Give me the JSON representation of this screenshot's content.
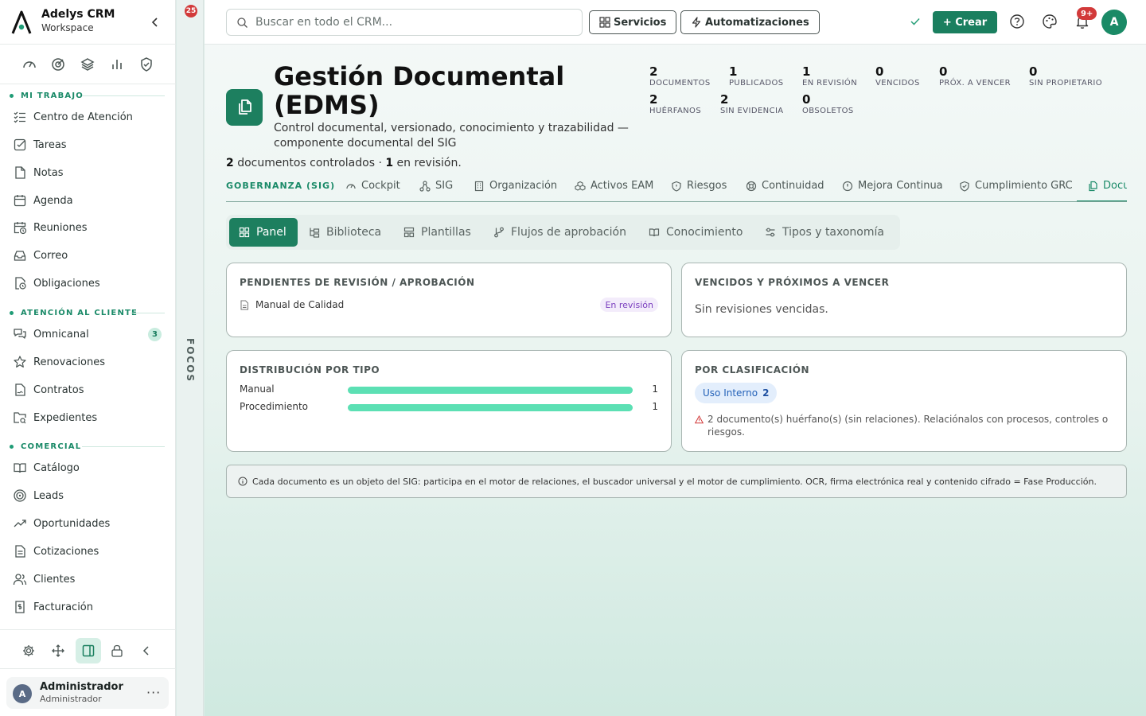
{
  "app": {
    "name": "Adelys CRM",
    "workspace": "Workspace"
  },
  "sidebar": {
    "sections": [
      {
        "title": "MI TRABAJO",
        "items": [
          {
            "label": "Centro de Atención",
            "icon": "list-check-icon"
          },
          {
            "label": "Tareas",
            "icon": "checkbox-icon"
          },
          {
            "label": "Notas",
            "icon": "note-icon"
          },
          {
            "label": "Agenda",
            "icon": "calendar-icon"
          },
          {
            "label": "Reuniones",
            "icon": "calendar-clock-icon"
          },
          {
            "label": "Correo",
            "icon": "inbox-icon"
          },
          {
            "label": "Obligaciones",
            "icon": "file-clock-icon"
          }
        ]
      },
      {
        "title": "ATENCIÓN AL CLIENTE",
        "items": [
          {
            "label": "Omnicanal",
            "icon": "chat-icon",
            "badge": "3"
          },
          {
            "label": "Renovaciones",
            "icon": "star-icon"
          },
          {
            "label": "Contratos",
            "icon": "file-signature-icon"
          },
          {
            "label": "Expedientes",
            "icon": "folder-search-icon"
          }
        ]
      },
      {
        "title": "COMERCIAL",
        "items": [
          {
            "label": "Catálogo",
            "icon": "book-open-icon"
          },
          {
            "label": "Leads",
            "icon": "target-icon"
          },
          {
            "label": "Oportunidades",
            "icon": "trending-up-icon"
          },
          {
            "label": "Cotizaciones",
            "icon": "file-text-icon"
          },
          {
            "label": "Clientes",
            "icon": "users-icon"
          },
          {
            "label": "Facturación",
            "icon": "receipt-icon"
          }
        ]
      }
    ],
    "user": {
      "initial": "A",
      "name": "Administrador",
      "role": "Administrador",
      "more": "···"
    }
  },
  "focos": {
    "label": "FOCOS",
    "badge": "25"
  },
  "topbar": {
    "search_placeholder": "Buscar en todo el CRM...",
    "services_label": "Servicios",
    "automations_label": "Automatizaciones",
    "create_label": "+ Crear",
    "notifications_badge": "9+",
    "avatar_initial": "A"
  },
  "page": {
    "title": "Gestión Documental (EDMS)",
    "description": "Control documental, versionado, conocimiento y trazabilidad — componente documental del SIG",
    "summary": {
      "count_docs": "2",
      "docs_text": " documentos controlados · ",
      "count_review": "1",
      "review_text": " en revisión."
    }
  },
  "kpis": [
    {
      "value": "2",
      "label": "DOCUMENTOS"
    },
    {
      "value": "1",
      "label": "PUBLICADOS"
    },
    {
      "value": "1",
      "label": "EN REVISIÓN"
    },
    {
      "value": "0",
      "label": "VENCIDOS"
    },
    {
      "value": "0",
      "label": "PRÓX. A VENCER"
    },
    {
      "value": "0",
      "label": "SIN PROPIETARIO"
    },
    {
      "value": "2",
      "label": "HUÉRFANOS"
    },
    {
      "value": "2",
      "label": "SIN EVIDENCIA"
    },
    {
      "value": "0",
      "label": "OBSOLETOS"
    }
  ],
  "gov_tabs": {
    "label": "GOBERNANZA (SIG)",
    "items": [
      "Cockpit",
      "SIG",
      "Organización",
      "Activos EAM",
      "Riesgos",
      "Continuidad",
      "Mejora Continua",
      "Cumplimiento GRC",
      "Docu"
    ]
  },
  "subtabs": [
    "Panel",
    "Biblioteca",
    "Plantillas",
    "Flujos de aprobación",
    "Conocimiento",
    "Tipos y taxonomía"
  ],
  "cards": {
    "pending": {
      "title": "PENDIENTES DE REVISIÓN / APROBACIÓN",
      "doc": "Manual de Calidad",
      "status": "En revisión"
    },
    "expired": {
      "title": "VENCIDOS Y PRÓXIMOS A VENCER",
      "empty": "Sin revisiones vencidas."
    },
    "by_type": {
      "title": "DISTRIBUCIÓN POR TIPO",
      "rows": [
        {
          "label": "Manual",
          "value": "1",
          "fraction": 1.0
        },
        {
          "label": "Procedimiento",
          "value": "1",
          "fraction": 1.0
        }
      ]
    },
    "by_class": {
      "title": "POR CLASIFICACIÓN",
      "chip_label": "Uso Interno",
      "chip_count": "2",
      "warning": "2 documento(s) huérfano(s) (sin relaciones). Relaciónalos con procesos, controles o riesgos."
    }
  },
  "info": "Cada documento es un objeto del SIG: participa en el motor de relaciones, el buscador universal y el motor de cumplimiento. OCR, firma electrónica real y contenido cifrado = Fase Producción.",
  "colors": {
    "accent": "#1a7f5f",
    "bar": "#5ce0b4",
    "danger": "#d23a3a",
    "review": "#7b3fbf"
  }
}
